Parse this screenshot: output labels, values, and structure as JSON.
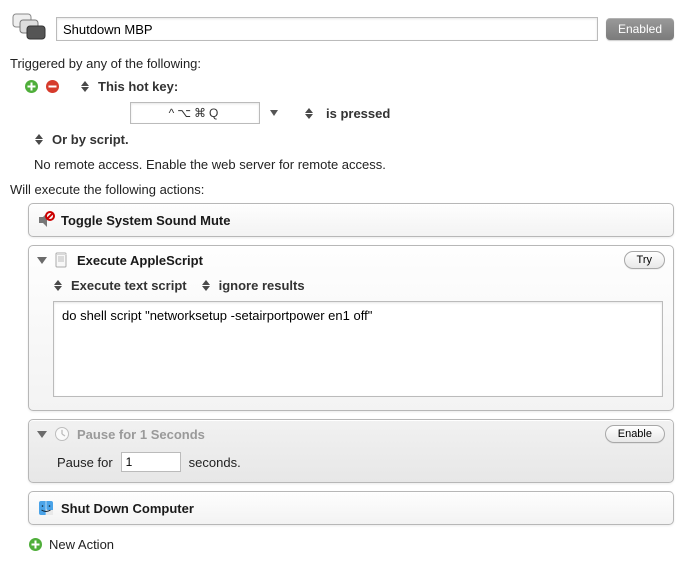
{
  "header": {
    "macro_name": "Shutdown MBP",
    "enabled_label": "Enabled"
  },
  "triggers": {
    "heading": "Triggered by any of the following:",
    "hotkey_label": "This hot key:",
    "hotkey_value": "^⌥⌘Q",
    "mode_label": "is pressed",
    "script_label": "Or by script.",
    "remote_note": "No remote access.  Enable the web server for remote access."
  },
  "actions_heading": "Will execute the following actions:",
  "actions": {
    "toggle_mute": {
      "title": "Toggle System Sound Mute"
    },
    "applescript": {
      "title": "Execute AppleScript",
      "try_label": "Try",
      "opt_mode": "Execute text script",
      "opt_results": "ignore results",
      "script": "do shell script \"networksetup -setairportpower en1 off\""
    },
    "pause": {
      "title": "Pause for 1 Seconds",
      "enable_label": "Enable",
      "prefix": "Pause for",
      "value": "1",
      "suffix": "seconds."
    },
    "shutdown": {
      "title": "Shut Down Computer"
    }
  },
  "new_action_label": "New Action"
}
